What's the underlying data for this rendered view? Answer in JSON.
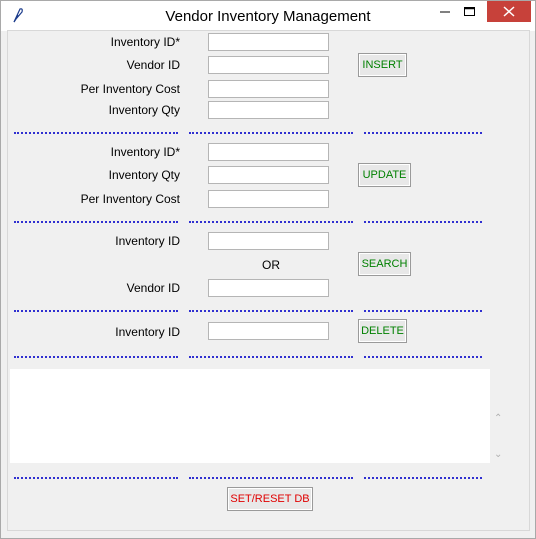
{
  "window": {
    "title": "Vendor Inventory Management"
  },
  "insert_section": {
    "labels": [
      "Inventory ID*",
      "Vendor ID",
      "Per Inventory Cost",
      "Inventory Qty"
    ],
    "button": "INSERT"
  },
  "update_section": {
    "labels": [
      "Inventory ID*",
      "Inventory Qty",
      "Per Inventory Cost"
    ],
    "button": "UPDATE"
  },
  "search_section": {
    "labels": [
      "Inventory ID",
      "Vendor ID"
    ],
    "or_text": "OR",
    "button": "SEARCH"
  },
  "delete_section": {
    "labels": [
      "Inventory ID"
    ],
    "button": "DELETE"
  },
  "reset_button": "SET/RESET DB",
  "icons": {
    "app": "feather-icon",
    "scroll_up": "chevron-up-icon",
    "scroll_down": "chevron-down-icon"
  },
  "colors": {
    "button_text_green": "#008000",
    "button_text_red": "#e00000",
    "separator_blue": "#3030d0",
    "close_red": "#c7413a"
  }
}
